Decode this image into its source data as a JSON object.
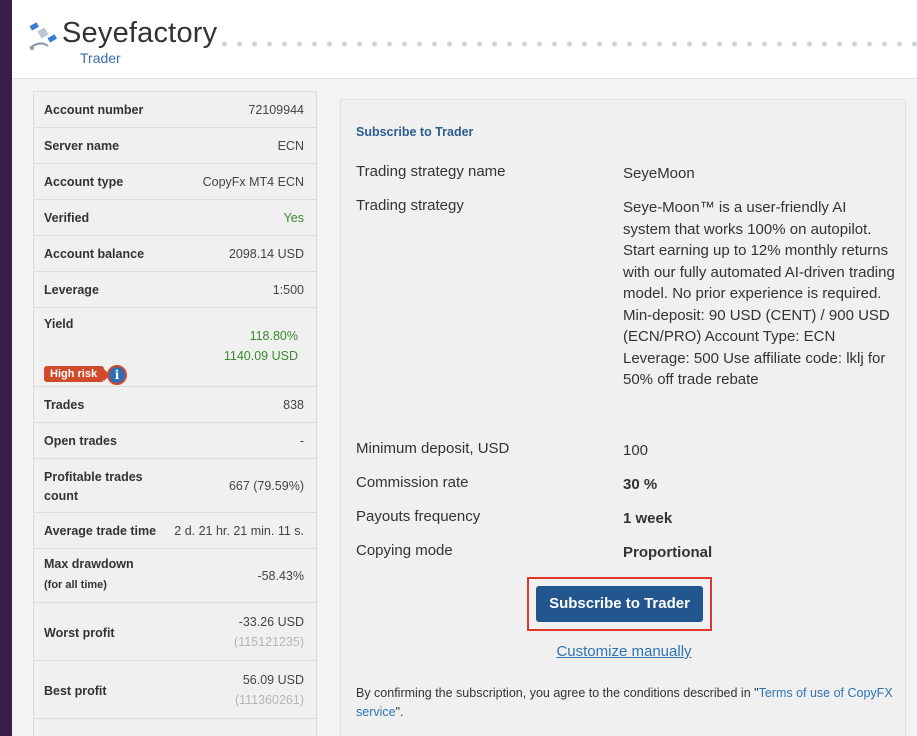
{
  "header": {
    "title": "Seyefactory",
    "subtitle": "Trader",
    "logo_icon": "satellite-icon"
  },
  "stats": [
    {
      "label": "Account number",
      "value": "72109944"
    },
    {
      "label": "Server name",
      "value": "ECN"
    },
    {
      "label": "Account type",
      "value": "CopyFx MT4 ECN"
    },
    {
      "label": "Verified",
      "value": "Yes"
    },
    {
      "label": "Account balance",
      "value": "2098.14 USD"
    },
    {
      "label": "Leverage",
      "value": "1:500"
    },
    {
      "label": "Yield",
      "value": "118.80%",
      "value2": "1140.09 USD",
      "badge": "High risk"
    },
    {
      "label": "Trades",
      "value": "838"
    },
    {
      "label": "Open trades",
      "value": "-"
    },
    {
      "label": "Profitable trades count",
      "value": "667 (79.59%)"
    },
    {
      "label": "Average trade time",
      "value": "2 d. 21 hr. 21 min. 11 s."
    },
    {
      "label": "Max drawdown",
      "sublabel": "(for all time)",
      "value": "-58.43%"
    },
    {
      "label": "Worst profit",
      "value": "-33.26 USD",
      "value2": "(115121235)"
    },
    {
      "label": "Best profit",
      "value": "56.09 USD",
      "value2": "(111360261)"
    }
  ],
  "subscribe": {
    "title": "Subscribe to Trader",
    "rows": [
      {
        "key": "Trading strategy name",
        "value": "SeyeMoon"
      },
      {
        "key": "Trading strategy",
        "value": "Seye-Moon™ is a user-friendly AI system that works 100% on autopilot. Start earning up to 12% monthly returns with our fully automated AI-driven trading model. No prior experience is required. Min-deposit: 90 USD (CENT) / 900 USD (ECN/PRO) Account Type: ECN Leverage: 500 Use affiliate code: lklj for 50% off trade rebate"
      },
      {
        "key": "Minimum deposit, USD",
        "value": "100"
      },
      {
        "key": "Commission rate",
        "value": "30 %"
      },
      {
        "key": "Payouts frequency",
        "value": "1 week"
      },
      {
        "key": "Copying mode",
        "value": "Proportional"
      }
    ],
    "button_label": "Subscribe to Trader",
    "customize_label": "Customize manually",
    "terms_prefix": "By confirming the subscription, you agree to the conditions described in \"",
    "terms_link": "Terms of use of CopyFX service",
    "terms_suffix": "\"."
  },
  "colors": {
    "background": "#3a1d4d",
    "accent": "#23568f",
    "link": "#2e74b5",
    "positive": "#3b8a2f",
    "risk": "#d04a2c",
    "highlight": "#e0362c"
  }
}
